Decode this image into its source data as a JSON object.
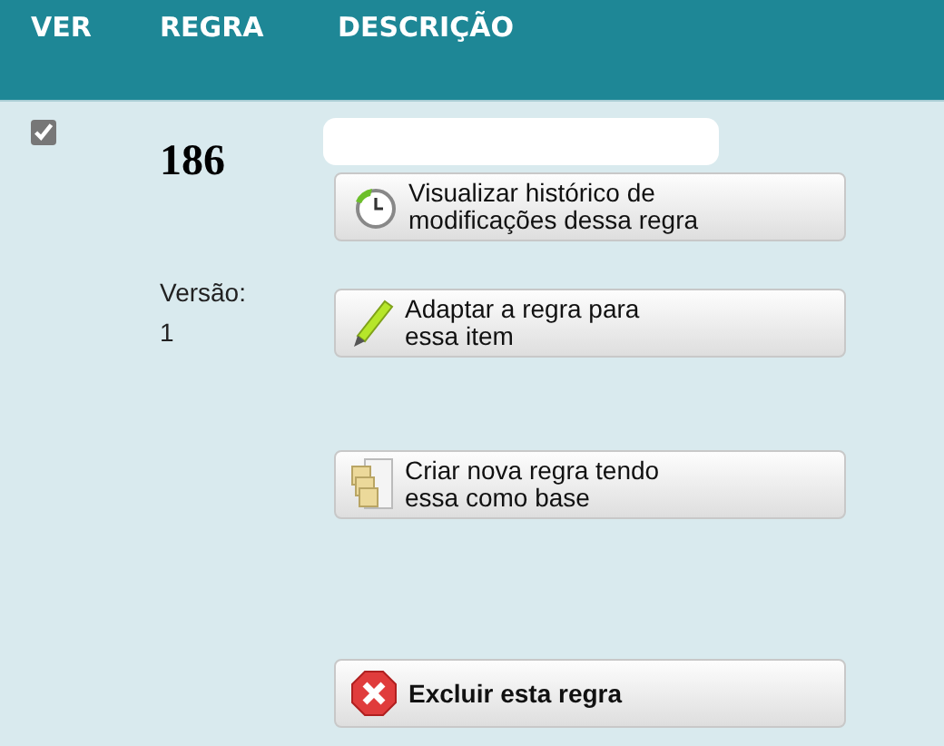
{
  "table": {
    "columns": [
      "VER",
      "REGRA",
      "DESCRIÇÃO"
    ],
    "row": {
      "ver_checked": true,
      "rule_number": "186",
      "version_label": "Versão:",
      "version_value": "1",
      "actions": [
        {
          "kind": "history",
          "label": "Visualizar histórico de modificações dessa regra"
        },
        {
          "kind": "edit",
          "label": "Adaptar a regra para essa item"
        },
        {
          "kind": "copy",
          "label": "Criar nova regra tendo essa como base"
        },
        {
          "kind": "delete",
          "label": "Excluir esta regra"
        }
      ]
    }
  }
}
